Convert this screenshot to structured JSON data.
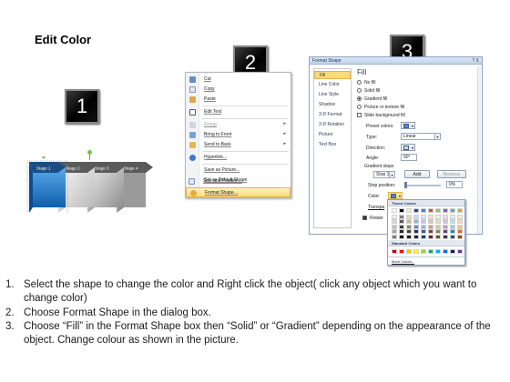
{
  "title": "Edit Color",
  "badges": [
    "1",
    "2",
    "3"
  ],
  "stages": [
    "Stage 1",
    "Stage 2",
    "Stage 3",
    "Stage 4"
  ],
  "context_menu": {
    "items": [
      {
        "label": "Cut",
        "icon": "scissors-icon",
        "disabled": false
      },
      {
        "label": "Copy",
        "icon": "copy-icon",
        "disabled": false
      },
      {
        "label": "Paste",
        "icon": "paste-icon",
        "disabled": false
      },
      {
        "label": "Edit Text",
        "icon": "edit-text-icon",
        "disabled": false
      },
      {
        "label": "Group",
        "icon": "group-icon",
        "disabled": true,
        "submenu": true
      },
      {
        "label": "Bring to Front",
        "icon": "bring-front-icon",
        "disabled": false,
        "submenu": true
      },
      {
        "label": "Send to Back",
        "icon": "send-back-icon",
        "disabled": false,
        "submenu": true
      },
      {
        "label": "Hyperlink...",
        "icon": "hyperlink-icon",
        "disabled": false
      },
      {
        "label": "Save as Picture...",
        "icon": "",
        "disabled": false
      },
      {
        "label": "Set as Default Shape",
        "icon": "",
        "disabled": false
      },
      {
        "label": "Size and Position...",
        "icon": "size-icon",
        "disabled": false
      },
      {
        "label": "Format Shape...",
        "icon": "format-shape-icon",
        "disabled": false,
        "highlighted": true
      }
    ]
  },
  "dialog": {
    "title": "Format Shape",
    "controls": "? X",
    "nav": [
      "Fill",
      "Line Color",
      "Line Style",
      "Shadow",
      "3-D Format",
      "3-D Rotation",
      "Picture",
      "Text Box"
    ],
    "pane_heading": "Fill",
    "fill_options": [
      {
        "label": "No fill",
        "type": "radio",
        "on": false
      },
      {
        "label": "Solid fill",
        "type": "radio",
        "on": false
      },
      {
        "label": "Gradient fill",
        "type": "radio",
        "on": true
      },
      {
        "label": "Picture or texture fill",
        "type": "radio",
        "on": false
      },
      {
        "label": "Slide background fill",
        "type": "check",
        "on": false
      }
    ],
    "preset_colors_label": "Preset colors:",
    "type_label": "Type:",
    "type_value": "Linear",
    "direction_label": "Direction:",
    "angle_label": "Angle:",
    "angle_value": "90°",
    "gradient_stops_label": "Gradient stops",
    "stop_value": "Stop 1",
    "add_button": "Add",
    "remove_button": "Remove",
    "stop_position_label": "Stop position:",
    "stop_position_value": "0%",
    "color_label": "Color:",
    "transparency_label": "Transpa",
    "rotate_label": "Rotate"
  },
  "palette": {
    "theme_heading": "Theme Colors",
    "standard_heading": "Standard Colors",
    "more": "More Colors...",
    "theme_top": [
      "#ffffff",
      "#000000",
      "#eeece1",
      "#1f497d",
      "#4f81bd",
      "#c0504d",
      "#9bbb59",
      "#8064a2",
      "#4bacc6",
      "#f79646"
    ],
    "theme_shades": [
      [
        "#f2f2f2",
        "#7f7f7f",
        "#ddd9c3",
        "#c6d9f0",
        "#dbe5f1",
        "#f2dcdb",
        "#ebf1dd",
        "#e5e0ec",
        "#dbeef3",
        "#fdeada"
      ],
      [
        "#d8d8d8",
        "#595959",
        "#c4bd97",
        "#8db3e2",
        "#b8cce4",
        "#e5b9b7",
        "#d7e3bc",
        "#ccc1d9",
        "#b7dde8",
        "#fbd5b5"
      ],
      [
        "#bfbfbf",
        "#3f3f3f",
        "#938953",
        "#548dd4",
        "#95b3d7",
        "#d99694",
        "#c3d69b",
        "#b2a2c7",
        "#92cddc",
        "#fac08f"
      ],
      [
        "#a5a5a5",
        "#262626",
        "#494429",
        "#17365d",
        "#366092",
        "#953734",
        "#76923c",
        "#5f497a",
        "#31859b",
        "#e36c09"
      ],
      [
        "#7f7f7f",
        "#0c0c0c",
        "#1d1b10",
        "#0f243e",
        "#244061",
        "#632423",
        "#4f6128",
        "#3f3151",
        "#205867",
        "#974806"
      ]
    ],
    "standard": [
      "#c00000",
      "#ff0000",
      "#ffc000",
      "#ffff00",
      "#92d050",
      "#00b050",
      "#00b0f0",
      "#0070c0",
      "#002060",
      "#7030a0"
    ]
  },
  "instructions": [
    {
      "n": "1.",
      "text": "Select the shape to change the color and Right click the object( click any object which you want to change color)"
    },
    {
      "n": "2.",
      "text": "Choose Format Shape in the dialog box."
    },
    {
      "n": "3.",
      "text": "Choose “Fill” in the Format Shape box then “Solid” or “Gradient” depending on the appearance of the object. Change colour as shown in the picture."
    }
  ]
}
